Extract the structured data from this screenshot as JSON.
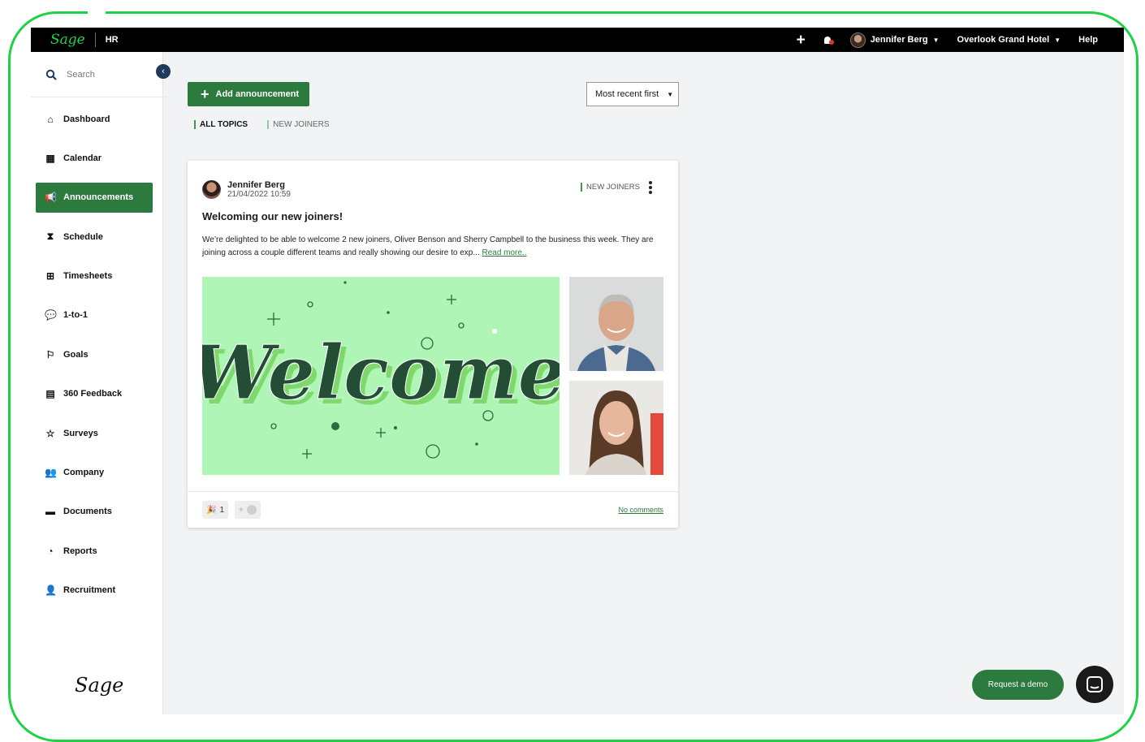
{
  "topbar": {
    "brand": "Sage",
    "app_name": "HR",
    "user_name": "Jennifer Berg",
    "company": "Overlook Grand Hotel",
    "help": "Help"
  },
  "sidebar": {
    "search_placeholder": "Search",
    "items": [
      {
        "label": "Dashboard",
        "icon": "home-icon"
      },
      {
        "label": "Calendar",
        "icon": "calendar-icon"
      },
      {
        "label": "Announcements",
        "icon": "megaphone-icon",
        "active": true
      },
      {
        "label": "Schedule",
        "icon": "hourglass-icon"
      },
      {
        "label": "Timesheets",
        "icon": "table-icon"
      },
      {
        "label": "1-to-1",
        "icon": "chat-bubbles-icon"
      },
      {
        "label": "Goals",
        "icon": "flag-icon"
      },
      {
        "label": "360 Feedback",
        "icon": "clipboard-icon"
      },
      {
        "label": "Surveys",
        "icon": "star-hand-icon"
      },
      {
        "label": "Company",
        "icon": "users-icon"
      },
      {
        "label": "Documents",
        "icon": "folder-icon"
      },
      {
        "label": "Reports",
        "icon": "pie-chart-icon"
      },
      {
        "label": "Recruitment",
        "icon": "user-plus-icon"
      }
    ],
    "footer_logo": "Sage"
  },
  "toolbar": {
    "add_label": "Add announcement",
    "sort_label": "Most recent first"
  },
  "topics": [
    "ALL TOPICS",
    "NEW JOINERS"
  ],
  "post": {
    "author": "Jennifer Berg",
    "datetime": "21/04/2022 10:59",
    "topic": "NEW JOINERS",
    "title": "Welcoming our new joiners!",
    "body": "We’re delighted to be able to welcome 2 new joiners, Oliver Benson and Sherry Campbell to the business this week. They are joining across a couple different teams and really showing our desire to exp...",
    "read_more": "Read more..",
    "image_text": "Welcome",
    "reaction_count": "1",
    "add_reaction": "+",
    "comments": "No comments"
  },
  "floating": {
    "demo_label": "Request a demo"
  },
  "colors": {
    "accent": "#2d7a3e",
    "frame": "#1fd146",
    "welcome_bg": "#aef5b6"
  }
}
